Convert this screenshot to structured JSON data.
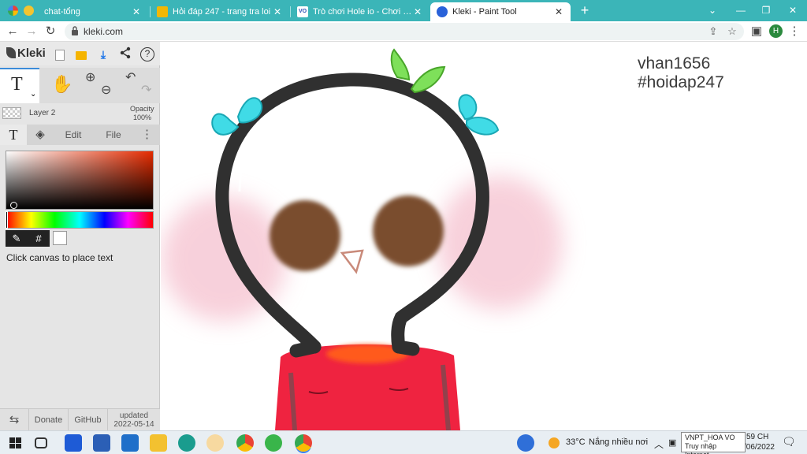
{
  "browser": {
    "tabs": [
      {
        "title": "chat-tổng",
        "active": false
      },
      {
        "title": "Hỏi đáp 247 - trang tra loi",
        "active": false
      },
      {
        "title": "Trò chơi Hole io - Chơi trực tuyến",
        "active": false
      },
      {
        "title": "Kleki - Paint Tool",
        "active": true
      }
    ],
    "new_tab": "+",
    "url": "kleki.com",
    "profile_initial": "H",
    "win_minimize": "⌄",
    "win_restore": "❐",
    "win_close": "✕"
  },
  "kleki": {
    "logo": "Kleki",
    "layer_name": "Layer 2",
    "opacity_label": "Opacity",
    "opacity_value": "100%",
    "tabs": {
      "edit": "Edit",
      "file": "File",
      "more": "⋮"
    },
    "hex_symbol": "#",
    "hint": "Click canvas to place text",
    "footer": {
      "swap": "⇆",
      "donate": "Donate",
      "github": "GitHub",
      "updated_label": "updated",
      "updated_date": "2022-05-14"
    },
    "tool_text_glyph": "T",
    "colors": {
      "primary": "#000000",
      "secondary": "#ffffff"
    }
  },
  "canvas": {
    "watermark_line1": "vhan1656",
    "watermark_line2": "#hoidap247"
  },
  "taskbar": {
    "temperature": "33°C",
    "weather": "Nắng nhiều nơi",
    "network_name": "VNPT_HOA VO",
    "network_status": "Truy nhập Internet",
    "time_fragment": "59 CH",
    "date_fragment": "/06/2022"
  }
}
